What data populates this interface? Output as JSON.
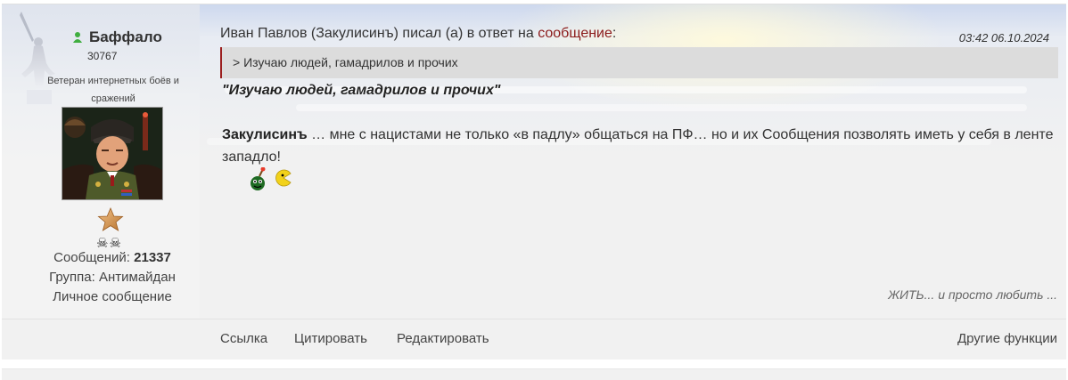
{
  "user": {
    "name": "Баффало",
    "id_number": "30767",
    "rank_title": "Ветеран интернетных боёв и сражений",
    "awards": "☠☠",
    "messages_label": "Сообщений:",
    "messages_count": "21337",
    "group_label": "Группа:",
    "group_value": "Антимайдан",
    "pm_label": "Личное сообщение"
  },
  "post": {
    "reply_author": "Иван Павлов (Закулисинъ) писал (а) в ответ на",
    "reply_link": "сообщение",
    "reply_colon": ":",
    "timestamp": "03:42 06.10.2024",
    "quote": "> Изучаю людей, гамадрилов и прочих",
    "highlight": "\"Изучаю людей, гамадрилов и прочих\"",
    "body_bold": "Закулисинъ",
    "body_text": " … мне с нацистами не только «в падлу» общаться на ПФ… но и их Сообщения позволять иметь у себя в ленте западло!",
    "signature": "ЖИТЬ... и просто любить ..."
  },
  "footer": {
    "link_label": "Ссылка",
    "quote_label": "Цитировать",
    "edit_label": "Редактировать",
    "other_label": "Другие функции"
  },
  "icons": {
    "online": "online-user-icon",
    "monument": "monument-icon",
    "star": "rank-star-icon",
    "smiley1": "bomb-smiley-icon",
    "smiley2": "pacman-smiley-icon"
  },
  "colors": {
    "link": "#8b1a1a",
    "online": "#3fae3f",
    "quote_border": "#9b1e1e"
  }
}
